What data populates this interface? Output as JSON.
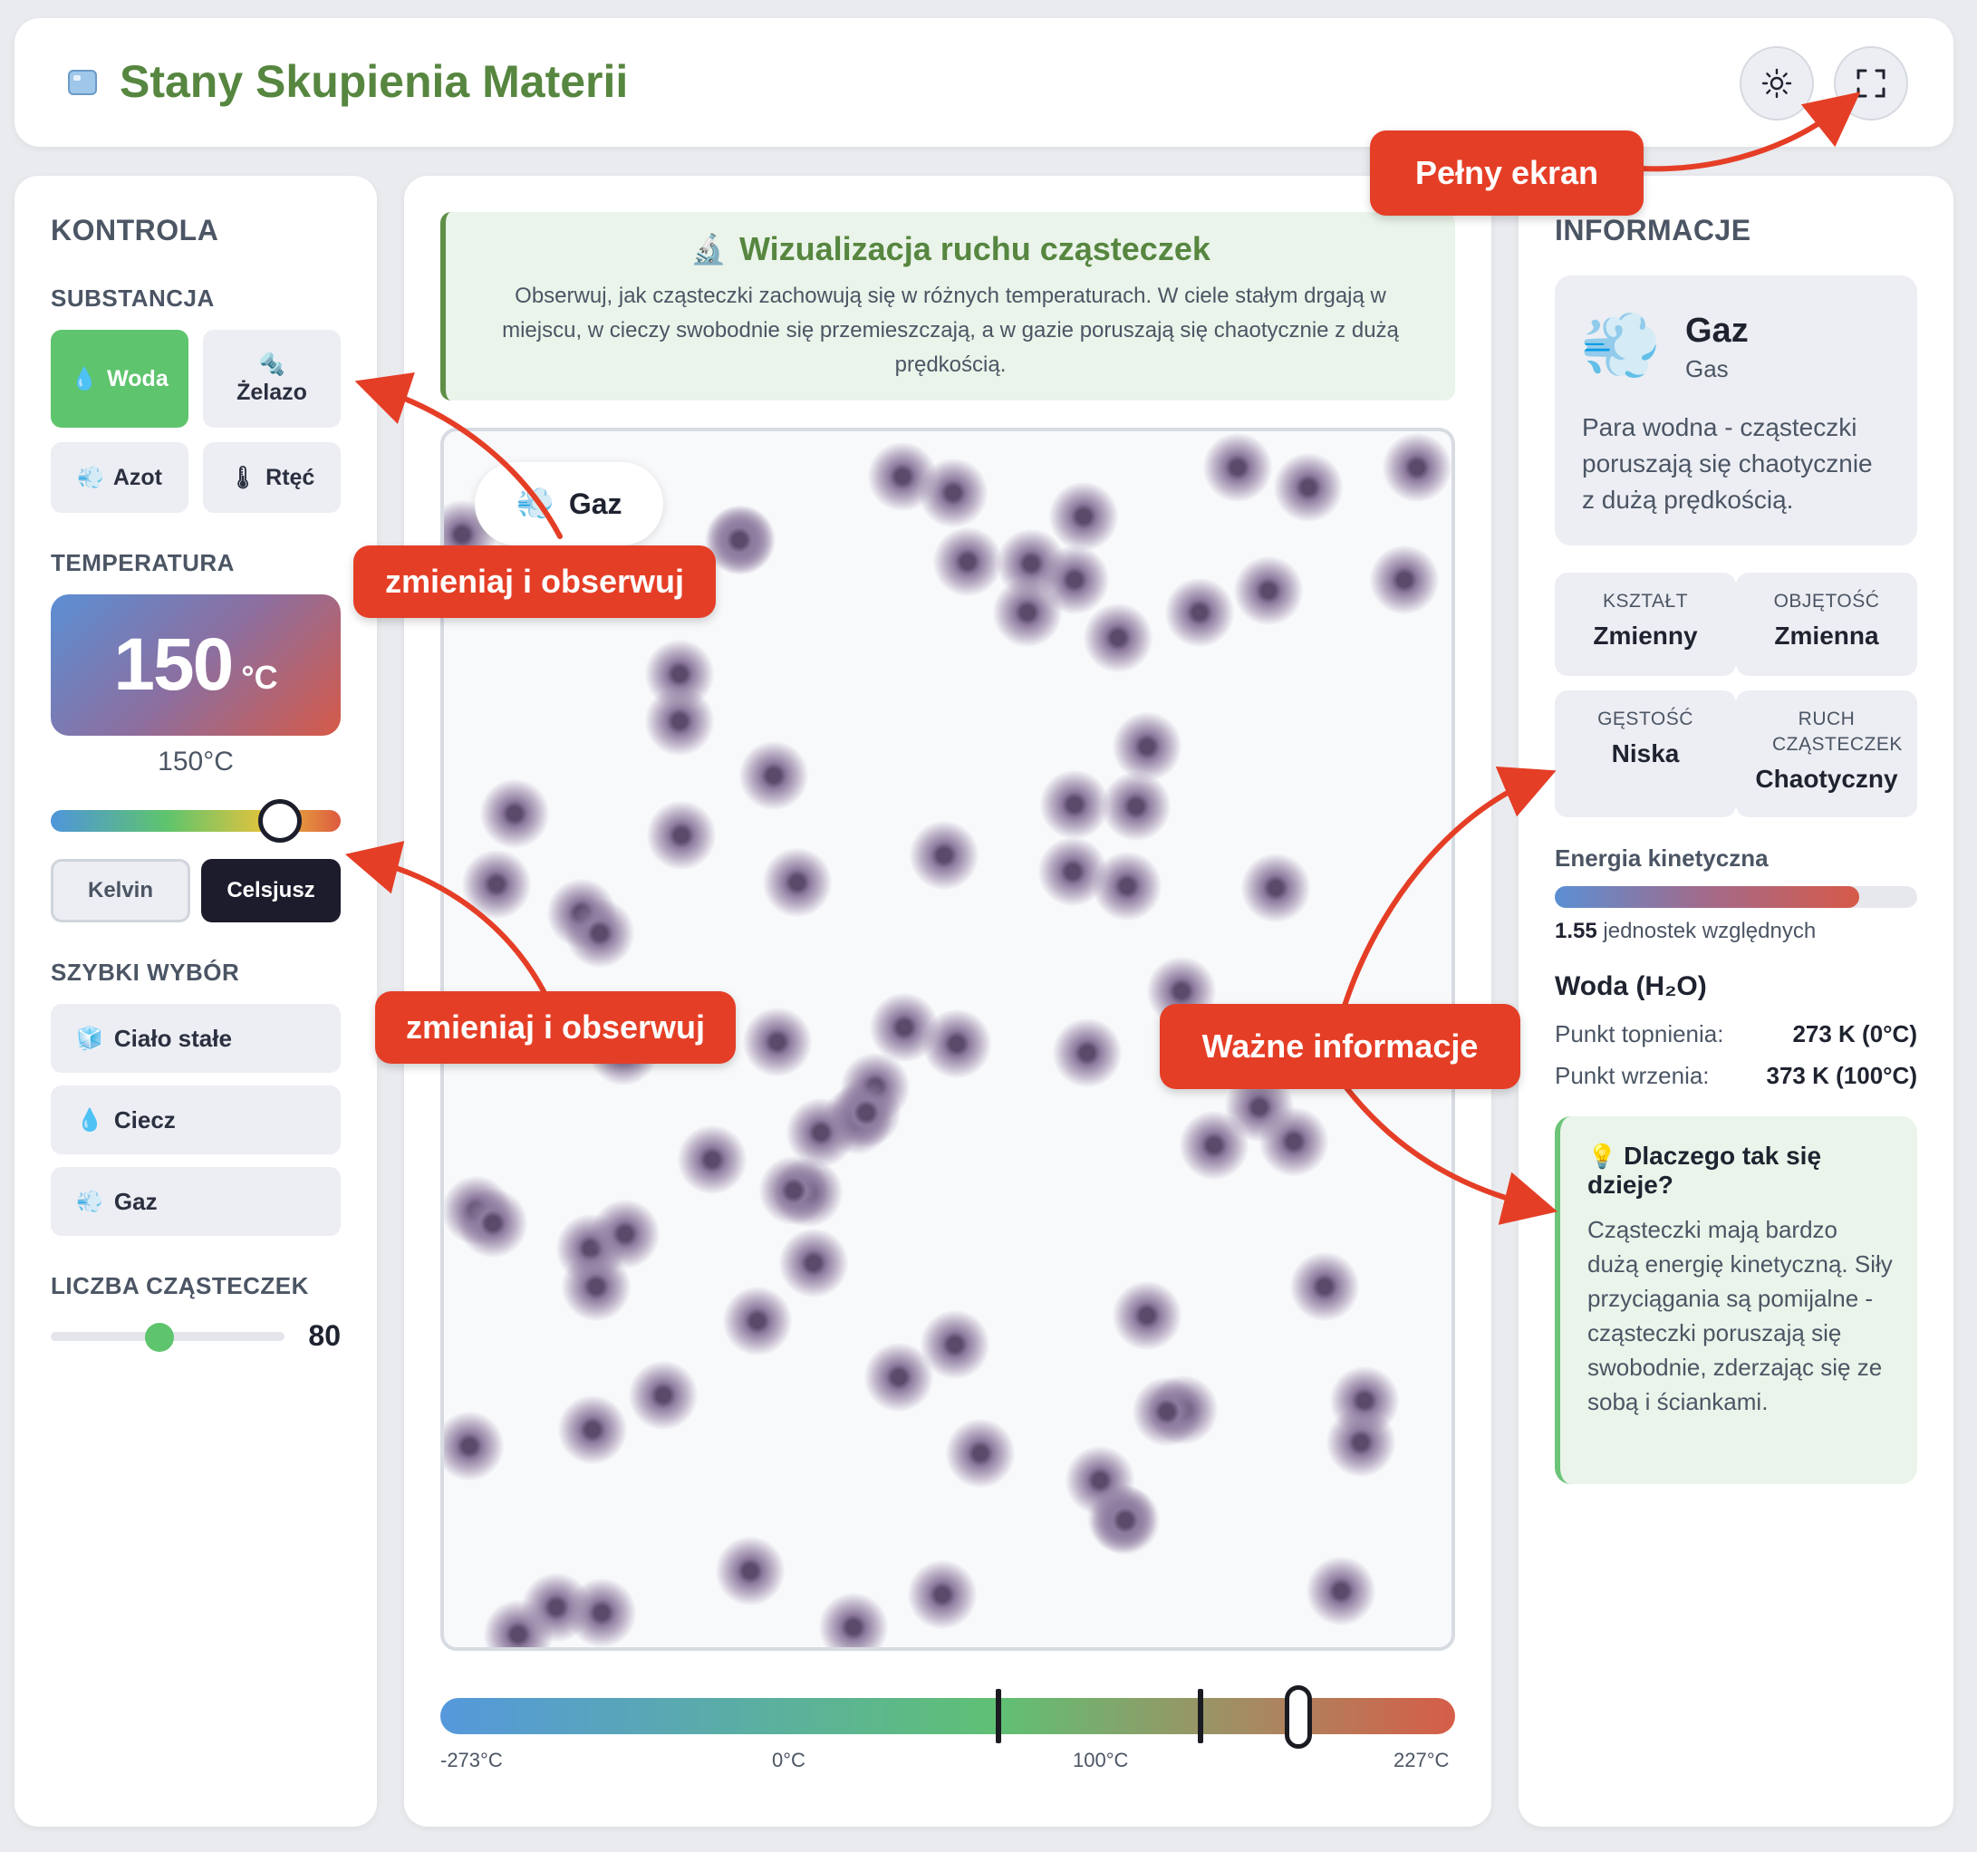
{
  "header": {
    "title": "Stany Skupienia Materii",
    "logo_icon": "ice-cube-icon",
    "theme_icon": "sun-icon",
    "fullscreen_icon": "fullscreen-icon"
  },
  "controls": {
    "title": "KONTROLA",
    "substance_label": "SUBSTANCJA",
    "substances": [
      {
        "label": "Woda",
        "icon": "droplet-icon",
        "active": true
      },
      {
        "label": "Żelazo",
        "icon": "bolt-icon",
        "active": false
      },
      {
        "label": "Azot",
        "icon": "wind-icon",
        "active": false
      },
      {
        "label": "Rtęć",
        "icon": "thermometer-icon",
        "active": false
      }
    ],
    "temperature_label": "TEMPERATURA",
    "temperature_value": "150",
    "temperature_unit": "°C",
    "temperature_sub": "150°C",
    "temperature_slider_fraction": 0.79,
    "unit_buttons": [
      {
        "label": "Kelvin",
        "active": false
      },
      {
        "label": "Celsjusz",
        "active": true
      }
    ],
    "quick_label": "SZYBKI WYBÓR",
    "quick": [
      {
        "label": "Ciało stałe",
        "icon": "ice-cube-icon"
      },
      {
        "label": "Ciecz",
        "icon": "droplet-icon"
      },
      {
        "label": "Gaz",
        "icon": "wind-icon"
      }
    ],
    "count_label": "LICZBA CZĄSTECZEK",
    "count_value": "80",
    "count_fraction": 0.46
  },
  "visualization": {
    "title": "Wizualizacja ruchu cząsteczek",
    "icon": "microscope-icon",
    "description": "Obserwuj, jak cząsteczki zachowują się w różnych temperaturach. W ciele stałym drgają w miejscu, w cieczy swobodnie się przemieszczają, a w gazie poruszają się chaotycznie z dużą prędkością.",
    "state_badge": "Gaz",
    "state_icon": "wind-icon",
    "scale_labels": [
      "-273°C",
      "0°C",
      "100°C",
      "227°C"
    ]
  },
  "info": {
    "title": "INFORMACJE",
    "state_name": "Gaz",
    "state_name_en": "Gas",
    "state_icon": "wind-icon",
    "state_desc": "Para wodna - cząsteczki poruszają się chaotycznie z dużą prędkością.",
    "stats": [
      {
        "label": "KSZTAŁT",
        "value": "Zmienny"
      },
      {
        "label": "OBJĘTOŚĆ",
        "value": "Zmienna"
      },
      {
        "label": "GĘSTOŚĆ",
        "value": "Niska"
      },
      {
        "label": "RUCH CZĄSTECZEK",
        "value": "Chaotyczny"
      }
    ],
    "kinetic_label": "Energia kinetyczna",
    "kinetic_value": "1.55",
    "kinetic_units": "jednostek względnych",
    "kinetic_fraction": 0.84,
    "substance_heading": "Woda (H₂O)",
    "melting_label": "Punkt topnienia:",
    "melting_value": "273 K (0°C)",
    "boiling_label": "Punkt wrzenia:",
    "boiling_value": "373 K (100°C)",
    "why_title": "Dlaczego tak się dzieje?",
    "why_icon": "lightbulb-icon",
    "why_text": "Cząsteczki mają bardzo dużą energię kinetyczną. Siły przyciągania są pomijalne - cząsteczki poruszają się swobodnie, zderzając się ze sobą i ściankami."
  },
  "annotations": {
    "fullscreen": "Pełny ekran",
    "change_observe_1": "zmieniaj i obserwuj",
    "change_observe_2": "zmieniaj i obserwuj",
    "important": "Ważne informacje"
  },
  "colors": {
    "accent_green": "#56863f",
    "active_green": "#5ec46d",
    "callout_red": "#e53e26",
    "particle": "#5b4a6a"
  }
}
